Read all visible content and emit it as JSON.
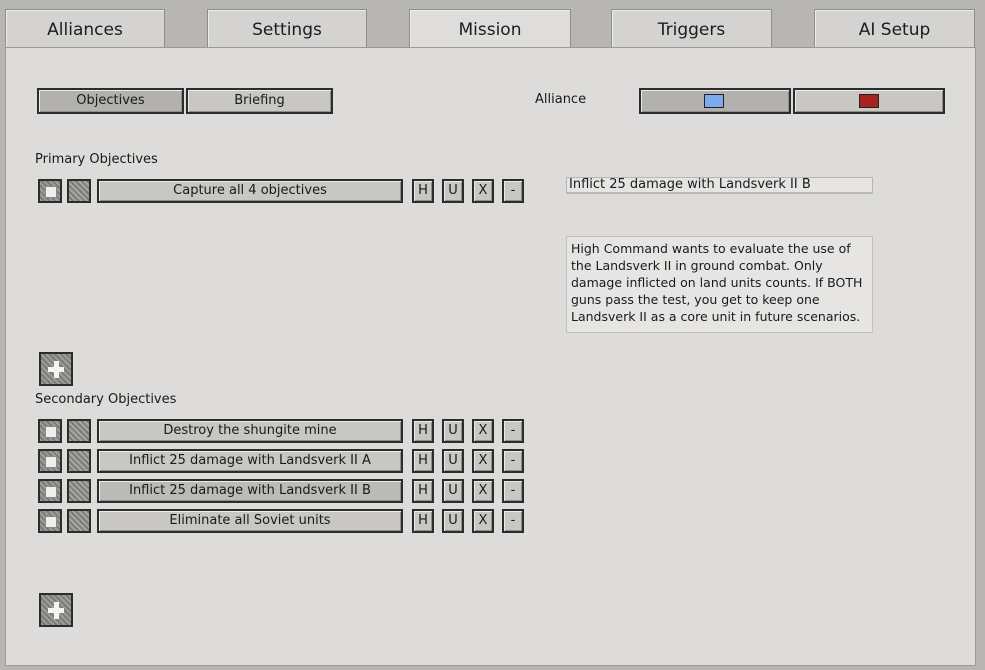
{
  "tabs": [
    {
      "label": "Alliances"
    },
    {
      "label": "Settings"
    },
    {
      "label": "Mission"
    },
    {
      "label": "Triggers"
    },
    {
      "label": "AI Setup"
    }
  ],
  "active_tab": "Mission",
  "subtabs": {
    "objectives": "Objectives",
    "briefing": "Briefing"
  },
  "alliance": {
    "label": "Alliance",
    "options": [
      {
        "color": "#7ea9ea"
      },
      {
        "color": "#a8231f"
      }
    ]
  },
  "primary": {
    "heading": "Primary Objectives",
    "items": [
      {
        "label": "Capture all 4 objectives"
      }
    ]
  },
  "secondary": {
    "heading": "Secondary Objectives",
    "items": [
      {
        "label": "Destroy the shungite mine"
      },
      {
        "label": "Inflict 25 damage with Landsverk II A"
      },
      {
        "label": "Inflict 25 damage with Landsverk II B"
      },
      {
        "label": "Eliminate all Soviet units"
      }
    ]
  },
  "row_buttons": {
    "h": "H",
    "u": "U",
    "x": "X",
    "minus": "-"
  },
  "detail": {
    "title": "Inflict 25 damage with Landsverk II B",
    "description": "High Command wants to evaluate the use of the Landsverk II in ground combat. Only damage inflicted on land units counts. If BOTH guns pass the test, you get to keep one Landsverk II as a core unit in future scenarios."
  }
}
